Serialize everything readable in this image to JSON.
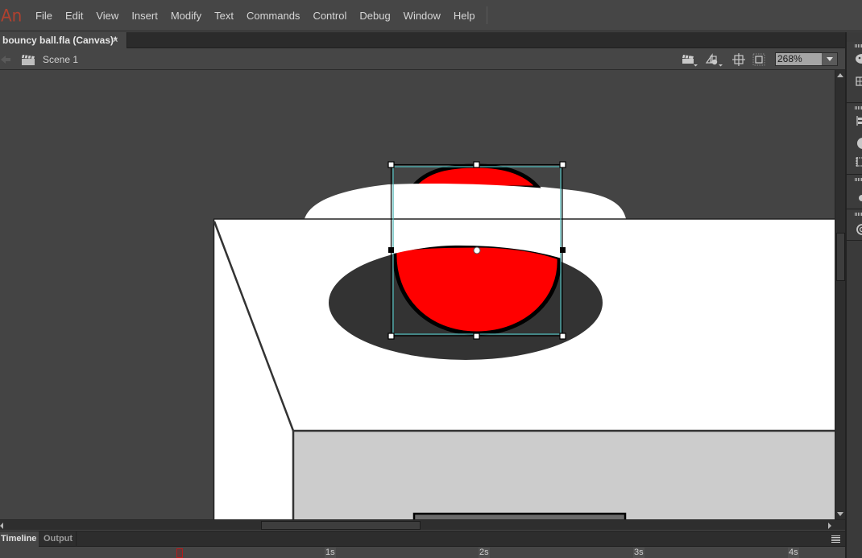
{
  "app": {
    "logo": "An",
    "menu": [
      "File",
      "Edit",
      "View",
      "Insert",
      "Modify",
      "Text",
      "Commands",
      "Control",
      "Debug",
      "Window",
      "Help"
    ]
  },
  "document": {
    "tab_title": "bouncy ball.fla (Canvas)*",
    "close_glyph": "×"
  },
  "editbar": {
    "scene_label": "Scene 1",
    "zoom_value": "268%",
    "icons": [
      "back-arrow-icon",
      "scene-clapper-icon",
      "edit-scene-icon",
      "edit-symbols-icon",
      "snap-to-center-icon",
      "clip-content-icon"
    ]
  },
  "stage": {
    "colors": {
      "pasteboard": "#444444",
      "ball_fill": "#ff0000",
      "ball_stroke": "#000000",
      "shadow": "#333333",
      "wall": "#ffffff",
      "floor_block": "#cccccc",
      "selection_box": "#4fb3b3"
    },
    "selected_object": "ball"
  },
  "right_panel": {
    "icons": [
      "color-palette-icon",
      "swatches-grid-icon",
      "align-icon",
      "color-circle-icon",
      "transform-icon",
      "brush-dot-icon",
      "cc-libraries-icon"
    ]
  },
  "timeline": {
    "tabs": [
      "Timeline",
      "Output"
    ],
    "ruler_labels": [
      "1s",
      "2s",
      "3s",
      "4s"
    ],
    "current_frame_marker": "playhead"
  },
  "accent": {
    "logo_color": "#b0412f",
    "playhead_color": "#b21c1c"
  }
}
